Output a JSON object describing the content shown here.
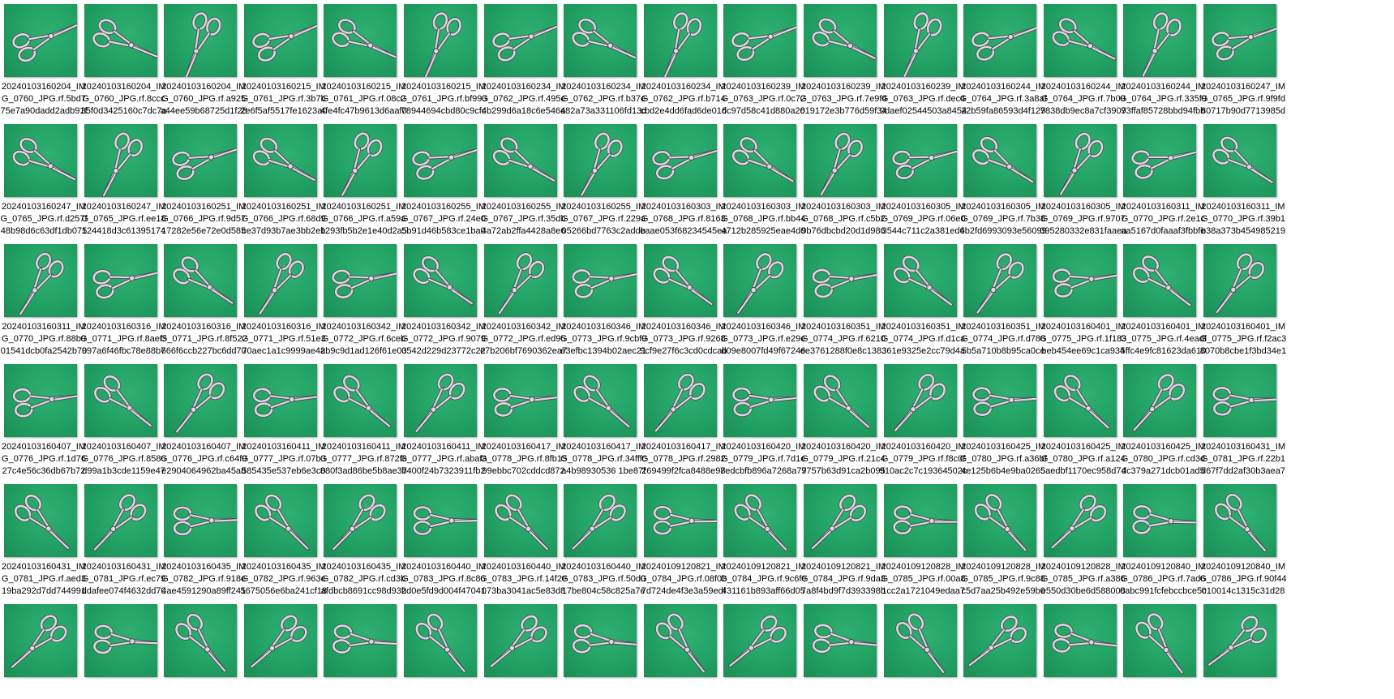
{
  "colors": {
    "thumb_green": "#24a466",
    "forceps_steel": "#d9d9de",
    "background": "#ffffff"
  },
  "item_icon": "forceps-thumbnail-icon",
  "rows": [
    [
      "20240103160204_IMG_0760_JPG.rf.5bd775e7a90dadd2adb91fb589e9...",
      "20240103160204_IMG_0760_JPG.rf.8ccc35f0d3425160c7dc7ac8c3589...",
      "20240103160204_IMG_0760_JPG.rf.a925a44ee59b68725d1f28b4ef8d68...",
      "20240103160215_IMG_0761_JPG.rf.3b7b2e6f5af5517fe1623a00e6aa8d93",
      "20240103160215_IMG_0761_JPG.rf.08c24fe4fc47b9613d6aaf0417fee6...",
      "20240103160215_IMG_0761_JPG.rf.bf99378944694cbd80c9cfce6bcfcd...",
      "20240103160234_IMG_0762_JPG.rf.495e4b299d6a18c6e5464cd726080...",
      "20240103160234_IMG_0762_JPG.rf.b37ea82a73a331106fd13d1a3840...",
      "20240103160234_IMG_0762_JPG.rf.b714cbd2e4dd6fad6de01d58a82...",
      "20240103160239_IMG_0763_JPG.rf.0c726c97d58c41d880a263ffc147e19c",
      "20240103160239_IMG_0763_JPG.rf.7e9f4019172e3b776d59f341f34e1b...",
      "20240103160239_IMG_0763_JPG.rf.dec40daef02544503a845450293b...",
      "20240103160244_IMG_0764_JPG.rf.3a8af22b59fa86593d4f1298d8bf8...",
      "20240103160244_IMG_0764_JPG.rf.7b097838db9ec8a7cf39072916c44...",
      "20240103160244_IMG_0764_JPG.rf.335f993ffaf85728bbd94fbb9b1015...",
      "20240103160247_IMG_0765_JPG.rf.9f9fd80717b90d7713985d32ce387f..."
    ],
    [
      "20240103160247_IMG_0765_JPG.rf.d257f48b98d6c63df1db075c6fa2a...",
      "20240103160247_IMG_0765_JPG.rf.ee18124418d3c6139517424ece31e...",
      "20240103160251_IMG_0766_JPG.rf.9d5717282e56e72e0d585e7c8ecdf...",
      "20240103160251_IMG_0766_JPG.rf.68d9ce37d93b7ae3bb2eb87752bd...",
      "20240103160251_IMG_0766_JPG.rf.a59a1293fb5b2e1e40d2a5b9e9641...",
      "20240103160255_IMG_0767_JPG.rf.24e05b91d46b583ce1ba0a12beb8...",
      "20240103160255_IMG_0767_JPG.rf.35db4a72ab2ffa4428a8e6c81bd04...",
      "20240103160255_IMG_0767_JPG.rf.229a05266bd7763c2addb350f8d40...",
      "20240103160303_IMG_0768_JPG.rf.8163eaae053f68234545ea401adba...",
      "20240103160303_IMG_0768_JPG.rf.bb444712b285925eae4d04ca4d9...",
      "20240103160303_IMG_0768_JPG.rf.c5b29b76dbcbd20d1d986e4f3fc18...",
      "20240103160305_IMG_0769_JPG.rf.06e03544c711c2a381ed66ef4f2539...",
      "20240103160305_IMG_0769_JPG.rf.7b384b2fd6993093e56099acdca8ff...",
      "20240103160305_IMG_0769_JPG.rf.9707095280332e831faaeabe275ccf...",
      "20240103160311_IMG_0770_JPG.rf.2e1caa5167d0faaaf3fbbfe556ad6f54",
      "20240103160311_IMG_0770_JPG.rf.39b1b38a373b4549852199f9f71baa..."
    ],
    [
      "20240103160311_IMG_0770_JPG.rf.88b901541dcb0fa2542b70bb02835...",
      "20240103160316_IMG_0771_JPG.rf.8aef5997a6f46fbc78e88b7b674961...",
      "20240103160316_IMG_0771_JPG.rf.8f522666f6ccb227bc6dd703a980e...",
      "20240103160316_IMG_0771_JPG.rf.51e370aec1a1c9999ae4273cfe40ce...",
      "20240103160342_IMG_0772_JPG.rf.6cebab9c9d1ad126f61e037597581...",
      "20240103160342_IMG_0772_JPG.rf.90790542d229d23772c22250e9937...",
      "20240103160342_IMG_0772_JPG.rf.ed95e7b206bf7690362ea79a22ba4...",
      "20240103160346_IMG_0773_JPG.rf.9cbf9e3efbc1394b02aec21f046b67...",
      "20240103160346_IMG_0773_JPG.rf.92689cf9e27f6c3cd0cdcab9af6a9...",
      "20240103160346_IMG_0773_JPG.rf.e29ed09e8007fd49f6724634b3c297...",
      "20240103160351_IMG_0774_JPG.rf.6210ee3761288f0e8c13835bf31ae2...",
      "20240103160351_IMG_0774_JPG.rf.d1ca361e9325e2cc79d4a1ffa61c4...",
      "20240103160351_IMG_0774_JPG.rf.d7885b5a710b8b95ca0cebda54c...",
      "20240103160401_IMG_0775_JPG.rf.1f183beb454ee69c1ca9344ae3720...",
      "20240103160401_IMG_0775_JPG.rf.4eadf5ffc4e9fc81623da610de10513a",
      "20240103160401_IMG_0775_JPG.rf.f2ac38070b8cbe1f3bd34e1d5649a..."
    ],
    [
      "20240103160407_IMG_0776_JPG.rf.1d7627c4e56c36db67b723b56db1...",
      "20240103160407_IMG_0776_JPG.rf.8586d99a1b3cde1159e4719c2b37...",
      "20240103160407_IMG_0776_JPG.rf.c64f9e2904064962ba45a89b548bb...",
      "20240103160411_IMG_0777_JPG.rf.07b3585435e537eb6e3c00e04286d...",
      "20240103160411_IMG_0777_JPG.rf.872f6880f3ad86be5b8ae377921cf0...",
      "20240103160411_IMG_0777_JPG.rf.abafab400f24b7323911fb242f6051...",
      "20240103160417_IMG_0778_JPG.rf.8fb1599ebbc702cddcd872db44b83...",
      "20240103160417_IMG_0778_JPG.rf.34fffca4b98930536 1be87f94f46e656",
      "20240103160417_IMG_0778_JPG.rf.2982269499f2fca8488e98bf586c0eaa",
      "20240103160420_IMG_0779_JPG.rf.7d1e7edcbfb896a7268a777445e8b...",
      "20240103160420_IMG_0779_JPG.rf.21c49757b63d91ca2b0956573da88...",
      "20240103160420_IMG_0779_JPG.rf.f8c0f910ac2c7c19364502ce28a07...",
      "20240103160425_IMG_0780_JPG.rf.a36bf4e125b6b4e9ba026520183c0...",
      "20240103160425_IMG_0780_JPG.rf.a1245aedbf1170ec958d74531f4bc...",
      "20240103160425_IMG_0780_JPG.rf.cd3ddc379a271dcb01ad563cfe83f...",
      "20240103160431_IMG_0781_JPG.rf.22b1d67f7dd2af30b3aea705cc109..."
    ],
    [
      "20240103160431_IMG_0781_JPG.rf.aed319ba292d7dd744991ea9998c...",
      "20240103160431_IMG_0781_JPG.rf.ec79ddafee074f4632dd70da4faa7...",
      "20240103160435_IMG_0782_JPG.rf.918e4ae4591290a89ff24188186cca...",
      "20240103160435_IMG_0782_JPG.rf.963e5675056e6ba241cf186a9a4f1d0f",
      "20240103160435_IMG_0782_JPG.rf.cd3bafdbcb8691cc98d93bbc4750...",
      "20240103160440_IMG_0783_JPG.rf.8c862d0e5fd9d004f470415fd3688b...",
      "20240103160440_IMG_0783_JPG.rf.14f2e073ba3041ac5e83d8b95a1c2...",
      "20240103160440_IMG_0783_JPG.rf.50d017be804c58c825a7ed47a9df9...",
      "20240109120821_IMG_0784_JPG.rf.08f0b7d724de4f3e3a59edf329d6a...",
      "20240109120821_IMG_0784_JPG.rf.9c6fe431161b893aff66d052f721df0c",
      "20240109120821_IMG_0784_JPG.rf.9da37a8f4bd9f7d393398bbd315b1...",
      "20240109120828_IMG_0785_JPG.rf.00a81cc2a1721049edaa76a67d0a5...",
      "20240109120828_IMG_0785_JPG.rf.9c88c5d7aa25b492e59b0587e394e...",
      "20240109120828_IMG_0785_JPG.rf.a386e550d30be6d58800865fab6fe...",
      "20240109120840_IMG_0786_JPG.rf.7ad60abc991fcfebccbce5c6dabbb...",
      "20240109120840_IMG_0786_JPG.rf.90f44010014c1315c31d289f8be43..."
    ],
    [
      "",
      "",
      "",
      "",
      "",
      "",
      "",
      "",
      "",
      "",
      "",
      "",
      "",
      "",
      "",
      ""
    ]
  ]
}
